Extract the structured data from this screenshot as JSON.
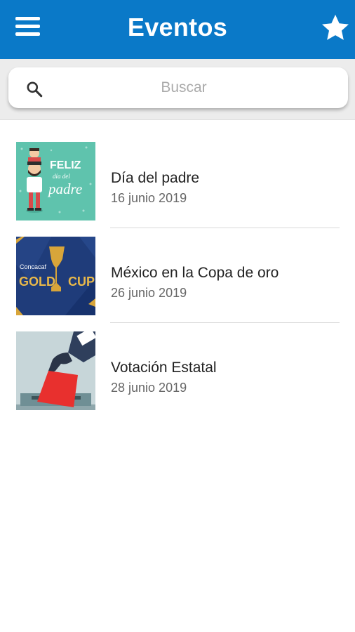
{
  "app": {
    "title": "Eventos",
    "menu_icon": "hamburger-menu-icon",
    "favorites_icon": "star-icon"
  },
  "search": {
    "placeholder": "Buscar",
    "icon": "search-icon",
    "value": ""
  },
  "events": [
    {
      "title": "Día del padre",
      "date": "16 junio 2019",
      "thumbnail_text": [
        "FELIZ",
        "día del",
        "padre"
      ]
    },
    {
      "title": "México en la Copa de oro",
      "date": "26 junio 2019",
      "thumbnail_text": [
        "Concacaf",
        "GOLD",
        "CUP"
      ]
    },
    {
      "title": "Votación Estatal",
      "date": "28 junio 2019",
      "thumbnail_text": []
    }
  ],
  "colors": {
    "appbar": "#0a79c8",
    "search_band": "#ececec",
    "gold": "#d8a53a",
    "teal": "#5fc3ad",
    "navy": "#1f3c7a"
  }
}
